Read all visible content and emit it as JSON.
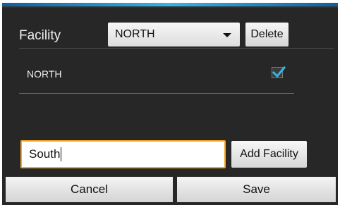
{
  "header": {
    "facility_label": "Facility",
    "selected_facility": "NORTH",
    "delete_label": "Delete"
  },
  "list": {
    "items": [
      {
        "label": "NORTH",
        "checked": true
      }
    ]
  },
  "add_form": {
    "input_value": "South",
    "add_label": "Add Facility"
  },
  "footer": {
    "cancel_label": "Cancel",
    "save_label": "Save"
  },
  "colors": {
    "accent": "#33b5e5",
    "input_focus": "#f5a623",
    "background": "#272727"
  },
  "icons": {
    "dropdown": "chevron-down-icon",
    "check": "check-icon"
  }
}
